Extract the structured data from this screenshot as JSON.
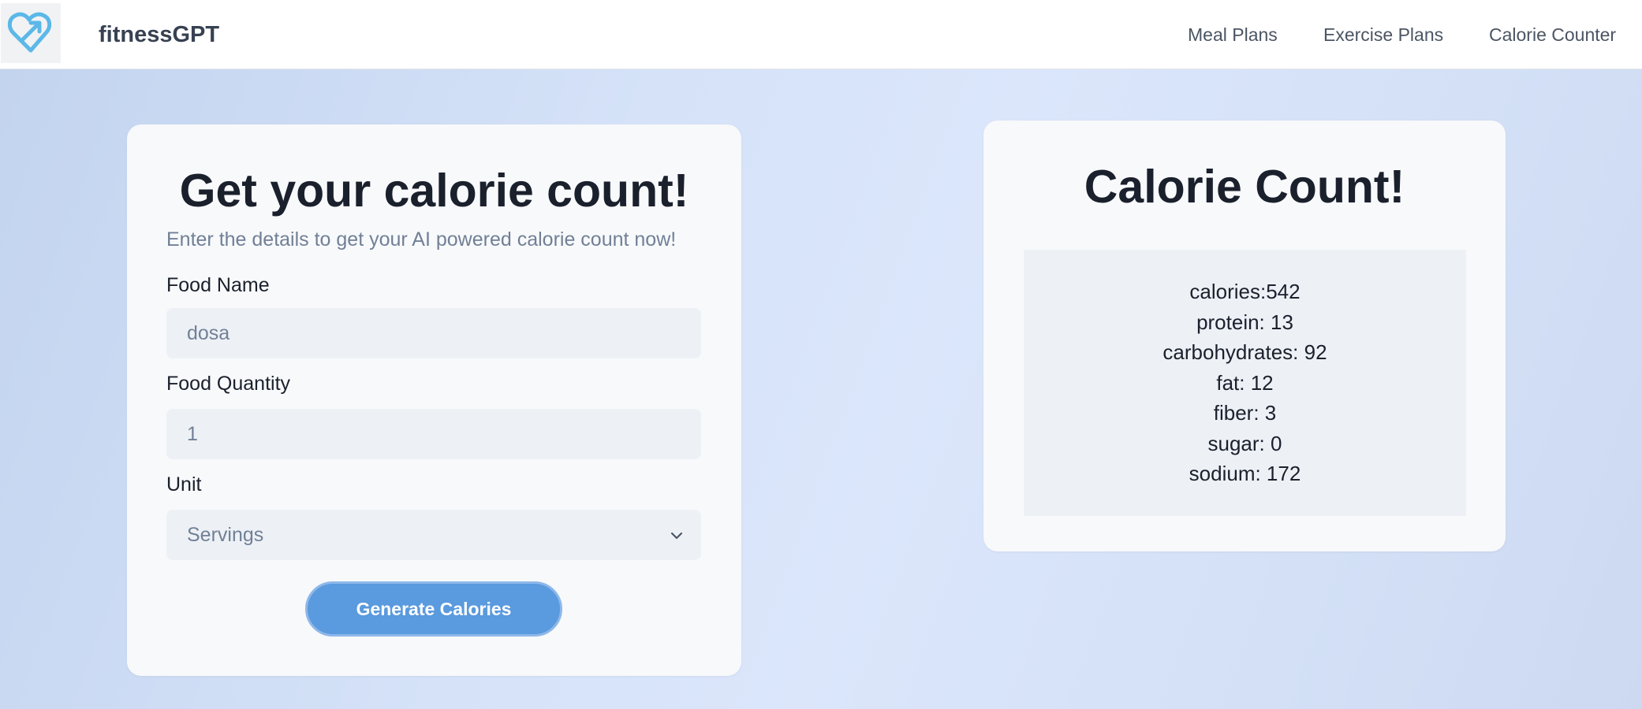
{
  "header": {
    "brand": "fitnessGPT",
    "logo_icon": "heart-arrow-icon",
    "nav": [
      "Meal Plans",
      "Exercise Plans",
      "Calorie Counter"
    ]
  },
  "form": {
    "title": "Get your calorie count!",
    "subtitle": "Enter the details to get your AI powered calorie count now!",
    "food_name_label": "Food Name",
    "food_name_value": "dosa",
    "food_quantity_label": "Food Quantity",
    "food_quantity_value": "1",
    "unit_label": "Unit",
    "unit_value": "Servings",
    "button_label": "Generate Calories"
  },
  "result": {
    "title": "Calorie Count!",
    "lines": [
      "calories:542",
      "protein: 13",
      "carbohydrates: 92",
      "fat: 12",
      "fiber: 3",
      "sugar: 0",
      "sodium: 172"
    ]
  },
  "colors": {
    "accent": "#5a9ade",
    "logo": "#5bb8e8",
    "text_dark": "#1a202c",
    "text_muted": "#718096"
  }
}
